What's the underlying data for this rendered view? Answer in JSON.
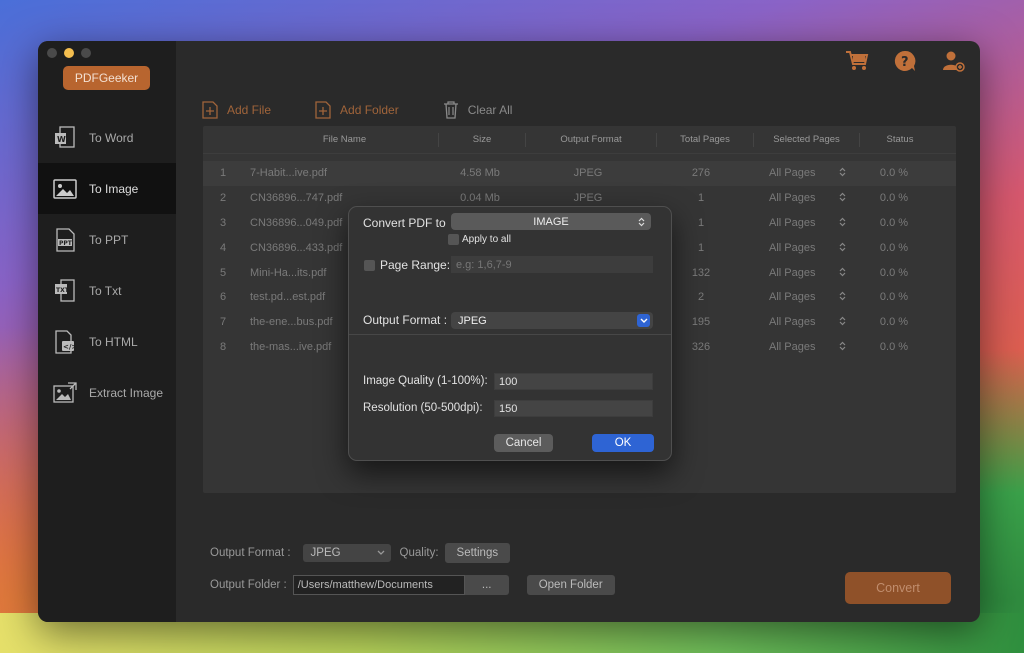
{
  "app": {
    "name": "PDFGeeker"
  },
  "sidebar": {
    "items": [
      {
        "label": "To Word",
        "icon": "word-doc-icon",
        "active": false
      },
      {
        "label": "To Image",
        "icon": "image-icon",
        "active": true
      },
      {
        "label": "To PPT",
        "icon": "ppt-doc-icon",
        "active": false
      },
      {
        "label": "To Txt",
        "icon": "txt-doc-icon",
        "active": false
      },
      {
        "label": "To HTML",
        "icon": "html-doc-icon",
        "active": false
      },
      {
        "label": "Extract Image",
        "icon": "extract-image-icon",
        "active": false
      }
    ]
  },
  "topbar": {
    "icons": [
      "cart-icon",
      "help-icon",
      "user-add-icon"
    ]
  },
  "toolbar": {
    "add_file": "Add File",
    "add_folder": "Add Folder",
    "clear_all": "Clear All"
  },
  "table": {
    "headers": [
      "File Name",
      "Size",
      "Output Format",
      "Total Pages",
      "Selected Pages",
      "Status"
    ],
    "rows": [
      {
        "idx": "1",
        "name": "7-Habit...ive.pdf",
        "size": "4.58 Mb",
        "format": "JPEG",
        "pages": "276",
        "selected": "All Pages",
        "status": "0.0 %"
      },
      {
        "idx": "2",
        "name": "CN36896...747.pdf",
        "size": "0.04 Mb",
        "format": "JPEG",
        "pages": "1",
        "selected": "All Pages",
        "status": "0.0 %"
      },
      {
        "idx": "3",
        "name": "CN36896...049.pdf",
        "size": "",
        "format": "",
        "pages": "1",
        "selected": "All Pages",
        "status": "0.0 %"
      },
      {
        "idx": "4",
        "name": "CN36896...433.pdf",
        "size": "",
        "format": "",
        "pages": "1",
        "selected": "All Pages",
        "status": "0.0 %"
      },
      {
        "idx": "5",
        "name": "Mini-Ha...its.pdf",
        "size": "",
        "format": "",
        "pages": "132",
        "selected": "All Pages",
        "status": "0.0 %"
      },
      {
        "idx": "6",
        "name": "test.pd...est.pdf",
        "size": "",
        "format": "",
        "pages": "2",
        "selected": "All Pages",
        "status": "0.0 %"
      },
      {
        "idx": "7",
        "name": "the-ene...bus.pdf",
        "size": "",
        "format": "",
        "pages": "195",
        "selected": "All Pages",
        "status": "0.0 %"
      },
      {
        "idx": "8",
        "name": "the-mas...ive.pdf",
        "size": "",
        "format": "",
        "pages": "326",
        "selected": "All Pages",
        "status": "0.0 %"
      }
    ]
  },
  "bottom": {
    "output_format_label": "Output Format :",
    "output_format_value": "JPEG",
    "quality_label": "Quality:",
    "settings_label": "Settings",
    "output_folder_label": "Output Folder :",
    "output_folder_value": "/Users/matthew/Documents",
    "browse_label": "...",
    "open_folder_label": "Open Folder",
    "convert_label": "Convert"
  },
  "dialog": {
    "convert_to_label": "Convert PDF to",
    "convert_to_value": "IMAGE",
    "apply_all_label": "Apply to all",
    "page_range_label": "Page Range:",
    "page_range_placeholder": "e.g: 1,6,7-9",
    "output_format_label": "Output Format :",
    "output_format_value": "JPEG",
    "quality_label": "Image Quality (1-100%):",
    "quality_value": "100",
    "resolution_label": "Resolution (50-500dpi):",
    "resolution_value": "150",
    "cancel_label": "Cancel",
    "ok_label": "OK"
  },
  "colors": {
    "accent": "#b8652f",
    "ok_button": "#2e64d4",
    "window_bg": "#2a2a2a"
  }
}
